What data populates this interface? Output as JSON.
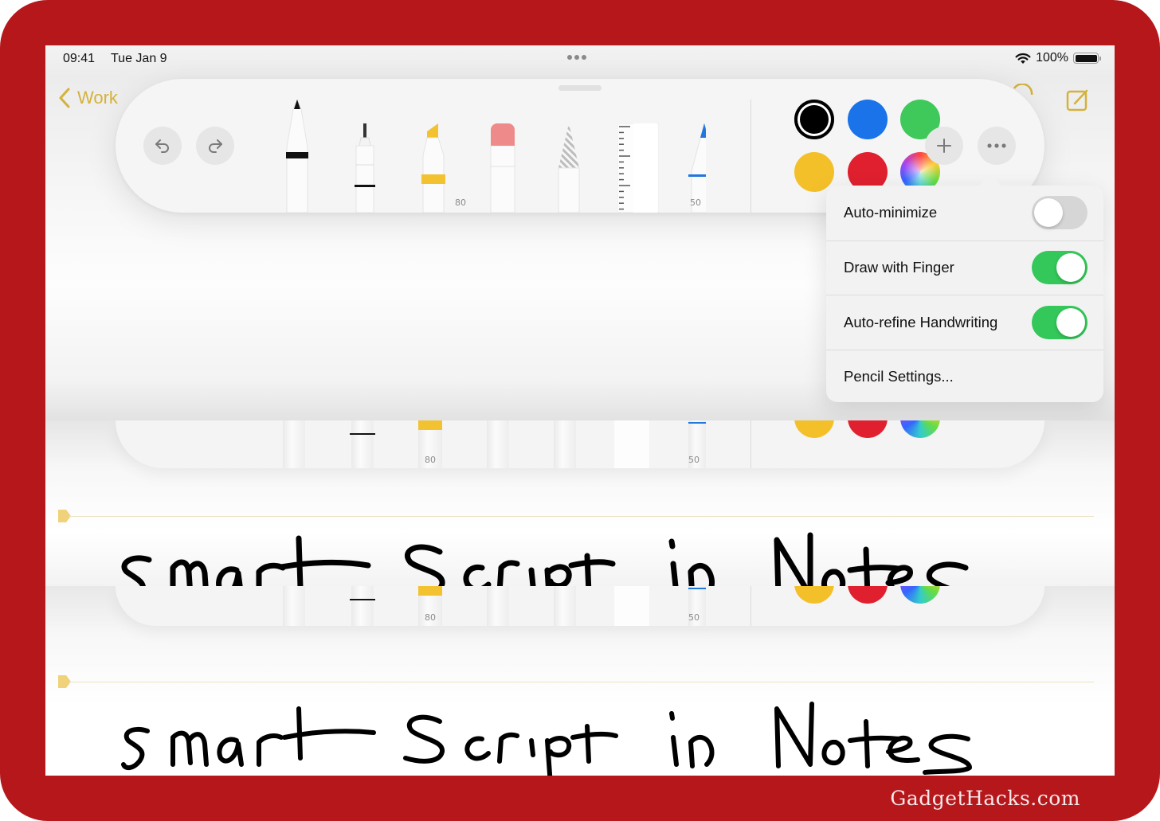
{
  "status_bar": {
    "time": "09:41",
    "date": "Tue Jan 9",
    "battery": "100%",
    "battery_level": 1.0,
    "wifi_icon": "wifi-icon",
    "multitasking_icon": "ellipsis-icon"
  },
  "navigation": {
    "back_label": "Work",
    "back_icon": "chevron-left-icon",
    "compose_icon": "compose-icon"
  },
  "colors": {
    "accent": "#d4b23c",
    "frame": "#b5171b",
    "toggle_on": "#34c759",
    "toggle_off": "#d6d6d6"
  },
  "toolbar": {
    "undo_icon": "undo-icon",
    "redo_icon": "redo-icon",
    "tools": [
      {
        "name": "pen",
        "color": "#111111",
        "label": ""
      },
      {
        "name": "monoline",
        "color": "#111111",
        "label": ""
      },
      {
        "name": "highlighter",
        "color": "#f2c230",
        "label": "80"
      },
      {
        "name": "eraser",
        "color": "#ef8a8a",
        "label": ""
      },
      {
        "name": "lasso",
        "color": "#bdbdbd",
        "label": ""
      },
      {
        "name": "ruler",
        "color": "#ffffff",
        "label": ""
      },
      {
        "name": "pencil",
        "color": "#2277dd",
        "label": "50"
      }
    ],
    "swatches": [
      {
        "name": "black",
        "color": "#000000",
        "selected": true
      },
      {
        "name": "blue",
        "color": "#1a73e8",
        "selected": false
      },
      {
        "name": "green",
        "color": "#3ec95a",
        "selected": false
      },
      {
        "name": "yellow",
        "color": "#f4c02a",
        "selected": false
      },
      {
        "name": "red",
        "color": "#e0202f",
        "selected": false
      },
      {
        "name": "multicolor",
        "color": "conic",
        "selected": false
      }
    ],
    "add_icon": "plus-icon",
    "more_icon": "ellipsis-icon"
  },
  "popover": {
    "items": [
      {
        "label": "Auto-minimize",
        "type": "toggle",
        "on": false
      },
      {
        "label": "Draw with Finger",
        "type": "toggle",
        "on": true
      },
      {
        "label": "Auto-refine Handwriting",
        "type": "toggle",
        "on": true
      },
      {
        "label": "Pencil Settings...",
        "type": "link"
      }
    ]
  },
  "note": {
    "handwriting_before": "smart Script in Notes",
    "handwriting_after": "smart Script in Notes"
  },
  "watermark": "GadgetHacks.com"
}
